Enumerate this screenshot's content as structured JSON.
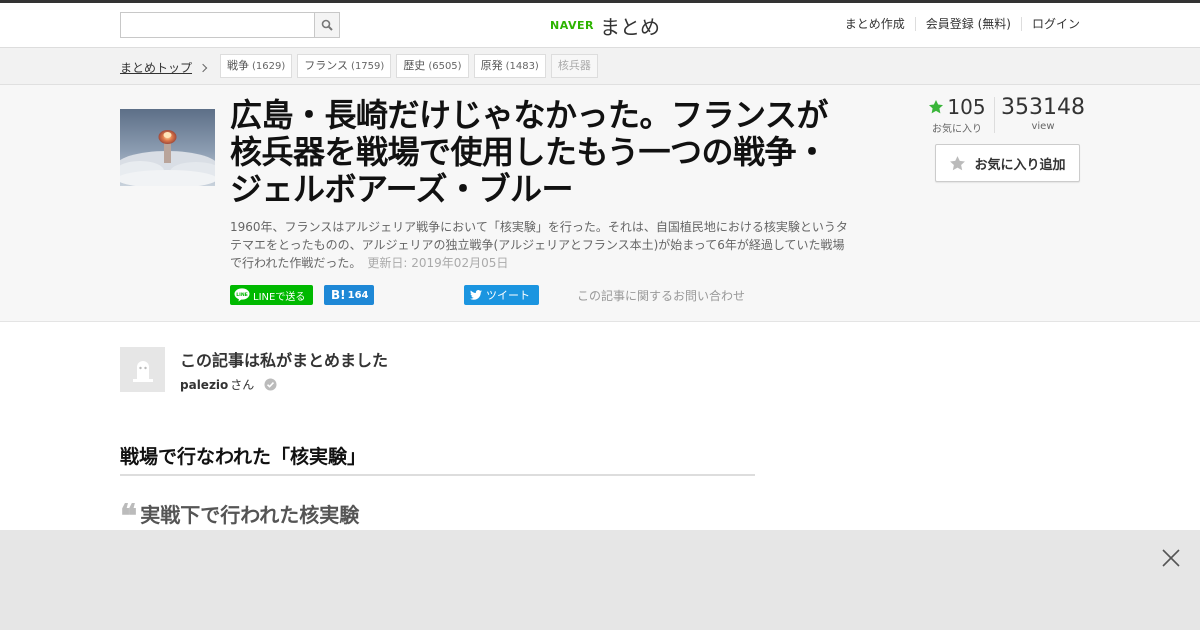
{
  "header": {
    "search": {
      "placeholder": "",
      "value": ""
    },
    "logo": {
      "naver": "NAVER",
      "matome": "まとめ"
    },
    "nav": [
      "まとめ作成",
      "会員登録 (無料)",
      "ログイン"
    ]
  },
  "tagbar": {
    "breadcrumb": "まとめトップ",
    "tags": [
      {
        "label": "戦争",
        "count": "(1629)"
      },
      {
        "label": "フランス",
        "count": "(1759)"
      },
      {
        "label": "歴史",
        "count": "(6505)"
      },
      {
        "label": "原発",
        "count": "(1483)"
      },
      {
        "label": "核兵器",
        "count": ""
      }
    ]
  },
  "article": {
    "title": "広島・長崎だけじゃなかった。フランスが核兵器を戦場で使用したもう一つの戦争・ジェルボアーズ・ブルー",
    "description": "1960年、フランスはアルジェリア戦争において「核実験」を行った。それは、自国植民地における核実験というタテマエをとったものの、アルジェリアの独立戦争(アルジェリアとフランス本土)が始まって6年が経過していた戦場で行われた作戦だった。",
    "updated": "更新日: 2019年02月05日",
    "share": {
      "line": "LINEで送る",
      "hatena_count": "164",
      "tweet": "ツイート",
      "contact": "この記事に関するお問い合わせ"
    }
  },
  "stats": {
    "favorites": "105",
    "favorites_label": "お気に入り",
    "views": "353148",
    "views_label": "view",
    "fav_button": "お気に入り追加"
  },
  "author": {
    "heading": "この記事は私がまとめました",
    "name": "palezio",
    "suffix": "さん"
  },
  "content": {
    "section_heading": "戦場で行なわれた「核実験」",
    "quote": "実戦下で行われた核実験"
  },
  "colors": {
    "naver_green": "#2db400",
    "line_green": "#00b900",
    "hatena_blue": "#1e88d6",
    "twitter_blue": "#1b95e0",
    "star_green": "#3ab53a"
  }
}
